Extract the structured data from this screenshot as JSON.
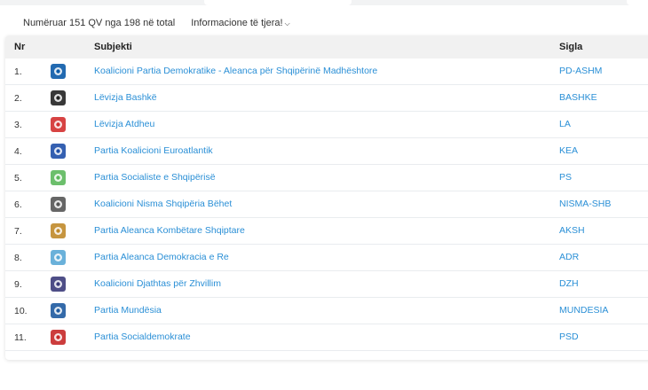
{
  "summary": {
    "count_text": "Numëruar 151 QV nga 198 në total",
    "more_info": "Informacione të tjera!",
    "chevron": "chevron-down-icon"
  },
  "table": {
    "headers": {
      "nr": "Nr",
      "subject": "Subjekti",
      "acronym": "Sigla"
    },
    "rows": [
      {
        "nr": "1.",
        "name": "Koalicioni Partia Demokratike - Aleanca për Shqipërinë Madhështore",
        "sigla": "PD-ASHM",
        "logo": "pd-logo-icon",
        "color": "#0a5aa8"
      },
      {
        "nr": "2.",
        "name": "Lëvizja Bashkë",
        "sigla": "BASHKE",
        "logo": "bashke-logo-icon",
        "color": "#222222"
      },
      {
        "nr": "3.",
        "name": "Lëvizja Atdheu",
        "sigla": "LA",
        "logo": "la-logo-icon",
        "color": "#d32f2f"
      },
      {
        "nr": "4.",
        "name": "Partia Koalicioni Euroatlantik",
        "sigla": "KEA",
        "logo": "kea-logo-icon",
        "color": "#1f4fa8"
      },
      {
        "nr": "5.",
        "name": "Partia Socialiste e Shqipërisë",
        "sigla": "PS",
        "logo": "ps-logo-icon",
        "color": "#5cb85c"
      },
      {
        "nr": "6.",
        "name": "Koalicioni Nisma Shqipëria Bëhet",
        "sigla": "NISMA-SHB",
        "logo": "nisma-logo-icon",
        "color": "#555555"
      },
      {
        "nr": "7.",
        "name": "Partia Aleanca Kombëtare Shqiptare",
        "sigla": "AKSH",
        "logo": "aksh-logo-icon",
        "color": "#c08a2a"
      },
      {
        "nr": "8.",
        "name": "Partia Aleanca Demokracia e Re",
        "sigla": "ADR",
        "logo": "adr-logo-icon",
        "color": "#5aa9d6"
      },
      {
        "nr": "9.",
        "name": "Koalicioni Djathtas për Zhvillim",
        "sigla": "DZH",
        "logo": "dzh-logo-icon",
        "color": "#3b3b7a"
      },
      {
        "nr": "10.",
        "name": "Partia Mundësia",
        "sigla": "MUNDESIA",
        "logo": "mundesia-logo-icon",
        "color": "#1e5aa0"
      },
      {
        "nr": "11.",
        "name": "Partia Socialdemokrate",
        "sigla": "PSD",
        "logo": "psd-logo-icon",
        "color": "#c62828"
      }
    ]
  }
}
